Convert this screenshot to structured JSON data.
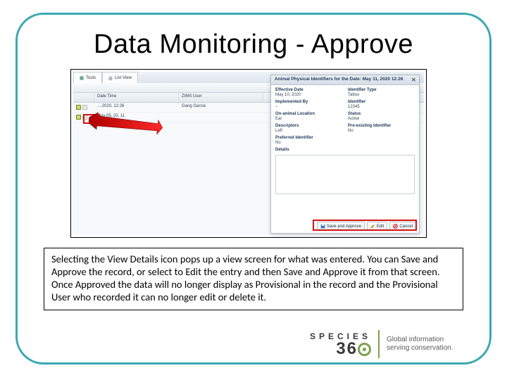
{
  "title": "Data Monitoring - Approve",
  "tabs": {
    "t1_label": "Tools",
    "t2_label": "List View"
  },
  "grid": {
    "col_date": "Date Time",
    "col_user": "ZIMS User",
    "row1_date": "... 2020, 12:26",
    "row1_user": "Gang Garcia",
    "row2_date": "May 05, 20, 11",
    "row2_user": ""
  },
  "modal": {
    "title": "Animal Physical Identifiers for the Date: May 11, 2020 12:26",
    "labels": {
      "effdate": "Effective Date",
      "idtype": "Identifier Type",
      "implby": "Implemented By",
      "ident": "Identifier",
      "loc": "On-animal Location",
      "status": "Status",
      "descr": "Descriptors",
      "preex": "Pre-existing Identifier",
      "pref": "Preferred Identifier",
      "details": "Details"
    },
    "values": {
      "effdate": "May 10, 2020",
      "idtype": "Tattoo",
      "implby": "~",
      "ident": "12345",
      "loc": "Ear",
      "status": "Active",
      "descr": "Left",
      "preex": "No",
      "pref": "No"
    },
    "buttons": {
      "save_approve": "Save and Approve",
      "edit": "Edit",
      "cancel": "Cancel"
    }
  },
  "explain": "Selecting the View Details icon pops up a view screen for what was entered. You can Save and Approve the record, or select to Edit the entry and then Save and Approve it from that screen. Once Approved the data will no longer display as Provisional in the record and the Provisional User who recorded it can no longer edit or delete it.",
  "logo": {
    "brand_top": "SPECIES",
    "brand_three": "3",
    "brand_six": "6",
    "tag1": "Global information",
    "tag2": "serving conservation."
  }
}
